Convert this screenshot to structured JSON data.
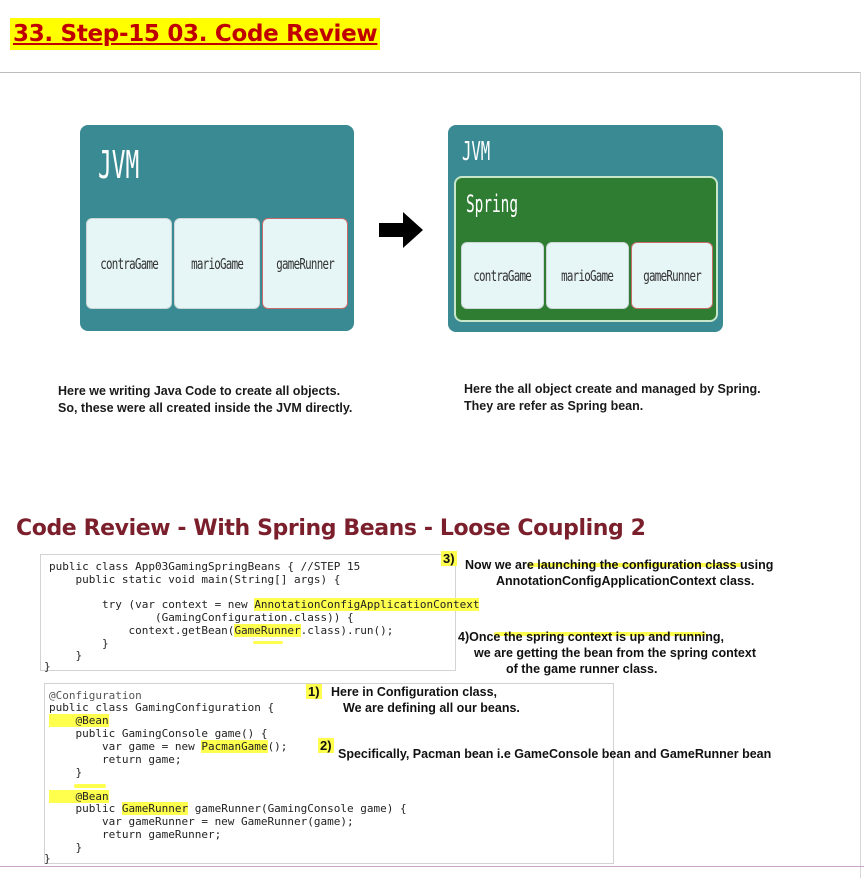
{
  "title": "33. Step-15 03. Code Review",
  "diagram_left": {
    "container_label": "JVM",
    "beans": [
      "contraGame",
      "marioGame",
      "gameRunner"
    ],
    "caption": [
      "Here we writing Java Code to create all objects.",
      "So, these were all created inside the JVM directly."
    ]
  },
  "diagram_right": {
    "container_label": "JVM",
    "inner_label": "Spring",
    "beans": [
      "contraGame",
      "marioGame",
      "gameRunner"
    ],
    "caption": [
      "Here the all object create and managed by Spring.",
      "They are refer as Spring bean."
    ]
  },
  "section_heading": "Code Review - With Spring Beans - Loose Coupling 2",
  "code_app": {
    "l1": "public class App03GamingSpringBeans { //STEP 15",
    "l2": "    public static void main(String[] args) {",
    "l3a": "        try (var context = new ",
    "l3b": "AnnotationConfigApplicationContext",
    "l4": "                (GamingConfiguration.class)) {",
    "l5a": "            context.getBean(",
    "l5b": "GameRunner",
    "l5c": ".class).run();",
    "l6": "        }",
    "l7": "    }",
    "l8": "}"
  },
  "code_config": {
    "l1": "@Configuration",
    "l2": "public class GamingConfiguration {",
    "l3": "    @Bean",
    "l4a": "    public GamingConsole game() {",
    "l5a": "        var game = new ",
    "l5b": "PacmanGame",
    "l5c": "();",
    "l6": "        return game;",
    "l7": "    }",
    "l8": "    @Bean",
    "l9a": "    public ",
    "l9b": "GameRunner",
    "l9c": " gameRunner(GamingConsole game) {",
    "l10": "        var gameRunner = new GameRunner(game);",
    "l11": "        return gameRunner;",
    "l12": "    }",
    "l13": "}"
  },
  "notes": {
    "n3_num": "3)",
    "n3_line1": "Now we are launching the configuration class using",
    "n3_line2": "AnnotationConfigApplicationContext class.",
    "n4_line1": "4)Once the spring context is up and running,",
    "n4_line2": "we are getting the bean from the spring context",
    "n4_line3": "of the game runner class.",
    "n1_num": "1)",
    "n1_line1": "Here in Configuration class,",
    "n1_line2": "We are defining all our beans.",
    "n2_num": "2)",
    "n2_line1": "Specifically, Pacman bean i.e GameConsole bean and GameRunner bean"
  },
  "colors": {
    "title_red": "#c00000",
    "highlight": "#ffff00",
    "jvm_teal": "#3a8a93",
    "spring_green": "#2e7d32",
    "heading_maroon": "#7a1f2b"
  }
}
